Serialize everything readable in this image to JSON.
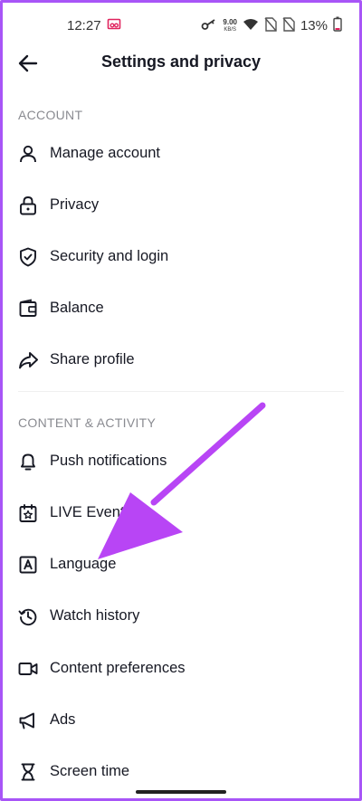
{
  "status": {
    "time": "12:27",
    "net_speed": "9.00",
    "net_unit": "KB/S",
    "battery": "13%"
  },
  "header": {
    "title": "Settings and privacy"
  },
  "sections": [
    {
      "label": "ACCOUNT",
      "items": [
        {
          "label": "Manage account",
          "icon": "person-icon"
        },
        {
          "label": "Privacy",
          "icon": "lock-icon"
        },
        {
          "label": "Security and login",
          "icon": "shield-icon"
        },
        {
          "label": "Balance",
          "icon": "wallet-icon"
        },
        {
          "label": "Share profile",
          "icon": "share-icon"
        }
      ]
    },
    {
      "label": "CONTENT & ACTIVITY",
      "items": [
        {
          "label": "Push notifications",
          "icon": "bell-icon"
        },
        {
          "label": "LIVE Events",
          "icon": "calendar-star-icon"
        },
        {
          "label": "Language",
          "icon": "language-icon"
        },
        {
          "label": "Watch history",
          "icon": "history-icon"
        },
        {
          "label": "Content preferences",
          "icon": "video-camera-icon"
        },
        {
          "label": "Ads",
          "icon": "megaphone-icon"
        },
        {
          "label": "Screen time",
          "icon": "hourglass-icon"
        }
      ]
    }
  ],
  "colors": {
    "annotation_arrow": "#b845f5",
    "frame": "#a855f7",
    "section_label": "#8a8b91"
  }
}
